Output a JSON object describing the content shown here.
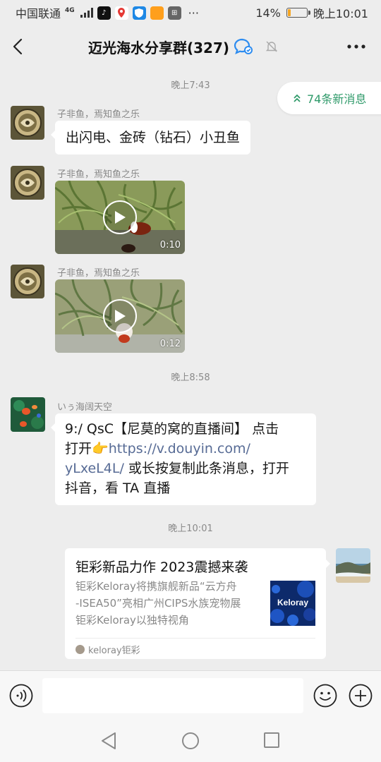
{
  "status": {
    "carrier": "中国联通",
    "network": "4G",
    "battery": "14%",
    "battery_level": 0.14,
    "time": "晚上10:01",
    "app_icons": [
      "tiktok-icon",
      "maps-icon",
      "security-icon",
      "orange-app-icon",
      "game-icon"
    ],
    "more": "···"
  },
  "header": {
    "title": "迈光海水分享群(327)",
    "back_icon": "chevron-left-icon",
    "more_icon": "more-dots-icon"
  },
  "new_messages": {
    "label": "74条新消息"
  },
  "timestamps": [
    "晚上7:43",
    "晚上8:58",
    "晚上10:01"
  ],
  "messages": [
    {
      "sender": "子非鱼，焉知鱼之乐",
      "text": "出闪电、金砖（钻石）小丑鱼"
    },
    {
      "sender": "子非鱼，焉知鱼之乐",
      "duration": "0:10"
    },
    {
      "sender": "子非鱼，焉知鱼之乐",
      "duration": "0:12"
    },
    {
      "sender": "いぅ海阔天空",
      "line1": "9:/ QsC【尼莫的窝的直播间】 点击",
      "line2_prefix": "打开",
      "emoji": "👉",
      "line2_link": "https://v.douyin.com/",
      "line3_link": "yLxeL4L/",
      "line3_rest": " 或长按复制此条消息，打开",
      "line4": "抖音，看 TA 直播"
    }
  ],
  "card": {
    "title": "钜彩新品力作 2023震撼来袭",
    "desc_line1": "钜彩Keloray将携旗舰新品“云方舟",
    "desc_line2": "-ISEA50”亮相广州CIPS水族宠物展",
    "desc_line3": "钜彩Keloray以独特视角",
    "thumb_text": "Keloray",
    "source": "keloray钜彩"
  },
  "input": {
    "placeholder": ""
  },
  "colors": {
    "background": "#ededed",
    "link": "#576b95",
    "new_msg_green": "#2f9a6a",
    "battery_orange": "#f5a623"
  }
}
